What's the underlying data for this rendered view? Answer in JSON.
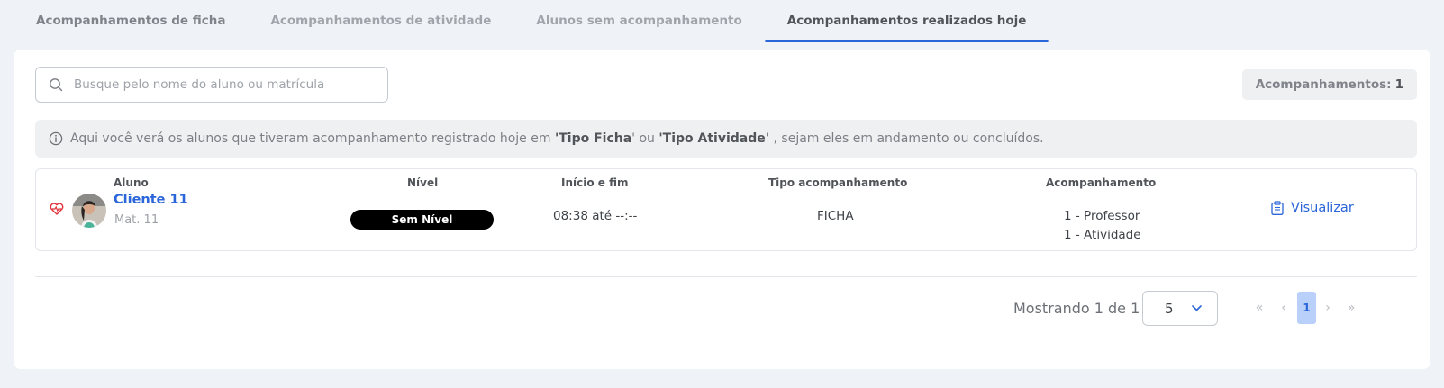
{
  "tabs": [
    {
      "label": "Acompanhamentos de ficha"
    },
    {
      "label": "Acompanhamentos de atividade"
    },
    {
      "label": "Alunos sem acompanhamento"
    },
    {
      "label": "Acompanhamentos realizados hoje"
    }
  ],
  "search": {
    "placeholder": "Busque pelo nome do aluno ou matrícula",
    "value": ""
  },
  "counter": {
    "label": "Acompanhamentos:",
    "value": "1"
  },
  "info": {
    "prefix": "Aqui você verá os alunos que tiveram acompanhamento registrado hoje em ",
    "quote1": "'",
    "bold1": "Tipo Ficha",
    "quote2": "'",
    "mid": " ou ",
    "quote3": "'",
    "bold2": "Tipo Atividade",
    "quote4": "'",
    "suffix": " , sejam eles em andamento ou concluídos."
  },
  "columns": {
    "aluno": "Aluno",
    "nivel": "Nível",
    "inicio_fim": "Início e fim",
    "tipo": "Tipo acompanhamento",
    "acompanhamento": "Acompanhamento"
  },
  "rows": [
    {
      "name": "Cliente 11",
      "mat": "Mat. 11",
      "level": "Sem Nível",
      "time": "08:38 até --:--",
      "type": "FICHA",
      "acomp_line1": "1 - Professor",
      "acomp_line2": "1 - Atividade",
      "action": "Visualizar"
    }
  ],
  "pagination": {
    "showing": "Mostrando 1 de 1",
    "page_size": "5",
    "first": "«",
    "prev": "‹",
    "current": "1",
    "next": "›",
    "last": "»"
  },
  "colors": {
    "accent": "#2a65d9",
    "heart": "#e0303a",
    "badge_bg": "#000000",
    "page_active_bg": "#b9d0fb"
  }
}
